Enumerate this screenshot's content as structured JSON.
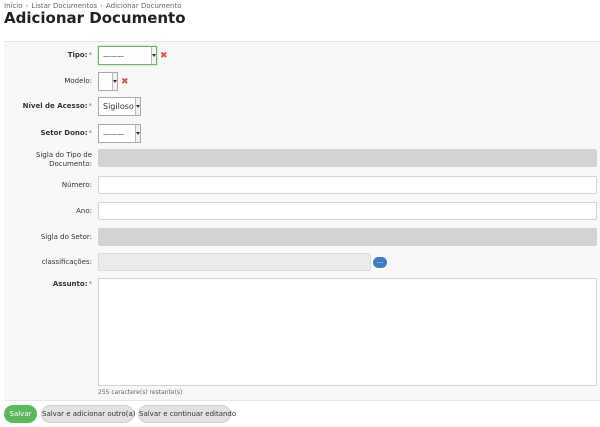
{
  "breadcrumb": {
    "items": [
      "Início",
      "Listar Documentos",
      "Adicionar Documento"
    ],
    "separator": "›"
  },
  "page": {
    "title": "Adicionar Documento"
  },
  "form": {
    "tipo": {
      "label": "Tipo:",
      "value": "———"
    },
    "modelo": {
      "label": "Modelo:",
      "value": ""
    },
    "nivel": {
      "label": "Nível de Acesso:",
      "value": "Sigiloso"
    },
    "setor_dono": {
      "label": "Setor Dono:",
      "value": "———"
    },
    "sigla_tipo": {
      "label_line1": "Sigla do Tipo de",
      "label_line2": "Documento:"
    },
    "numero": {
      "label": "Número:"
    },
    "ano": {
      "label": "Ano:"
    },
    "sigla_setor": {
      "label": "Sigla do Setor:"
    },
    "classificacoes": {
      "label": "classificações:",
      "button": "..."
    },
    "assunto": {
      "label": "Assunto:",
      "help": "255 caractere(s) restante(s)"
    },
    "required_marker": "*",
    "remove_icon": "✖"
  },
  "actions": {
    "save": "Salvar",
    "save_add_another": "Salvar e adicionar outro(a)",
    "save_continue": "Salvar e continuar editando"
  }
}
